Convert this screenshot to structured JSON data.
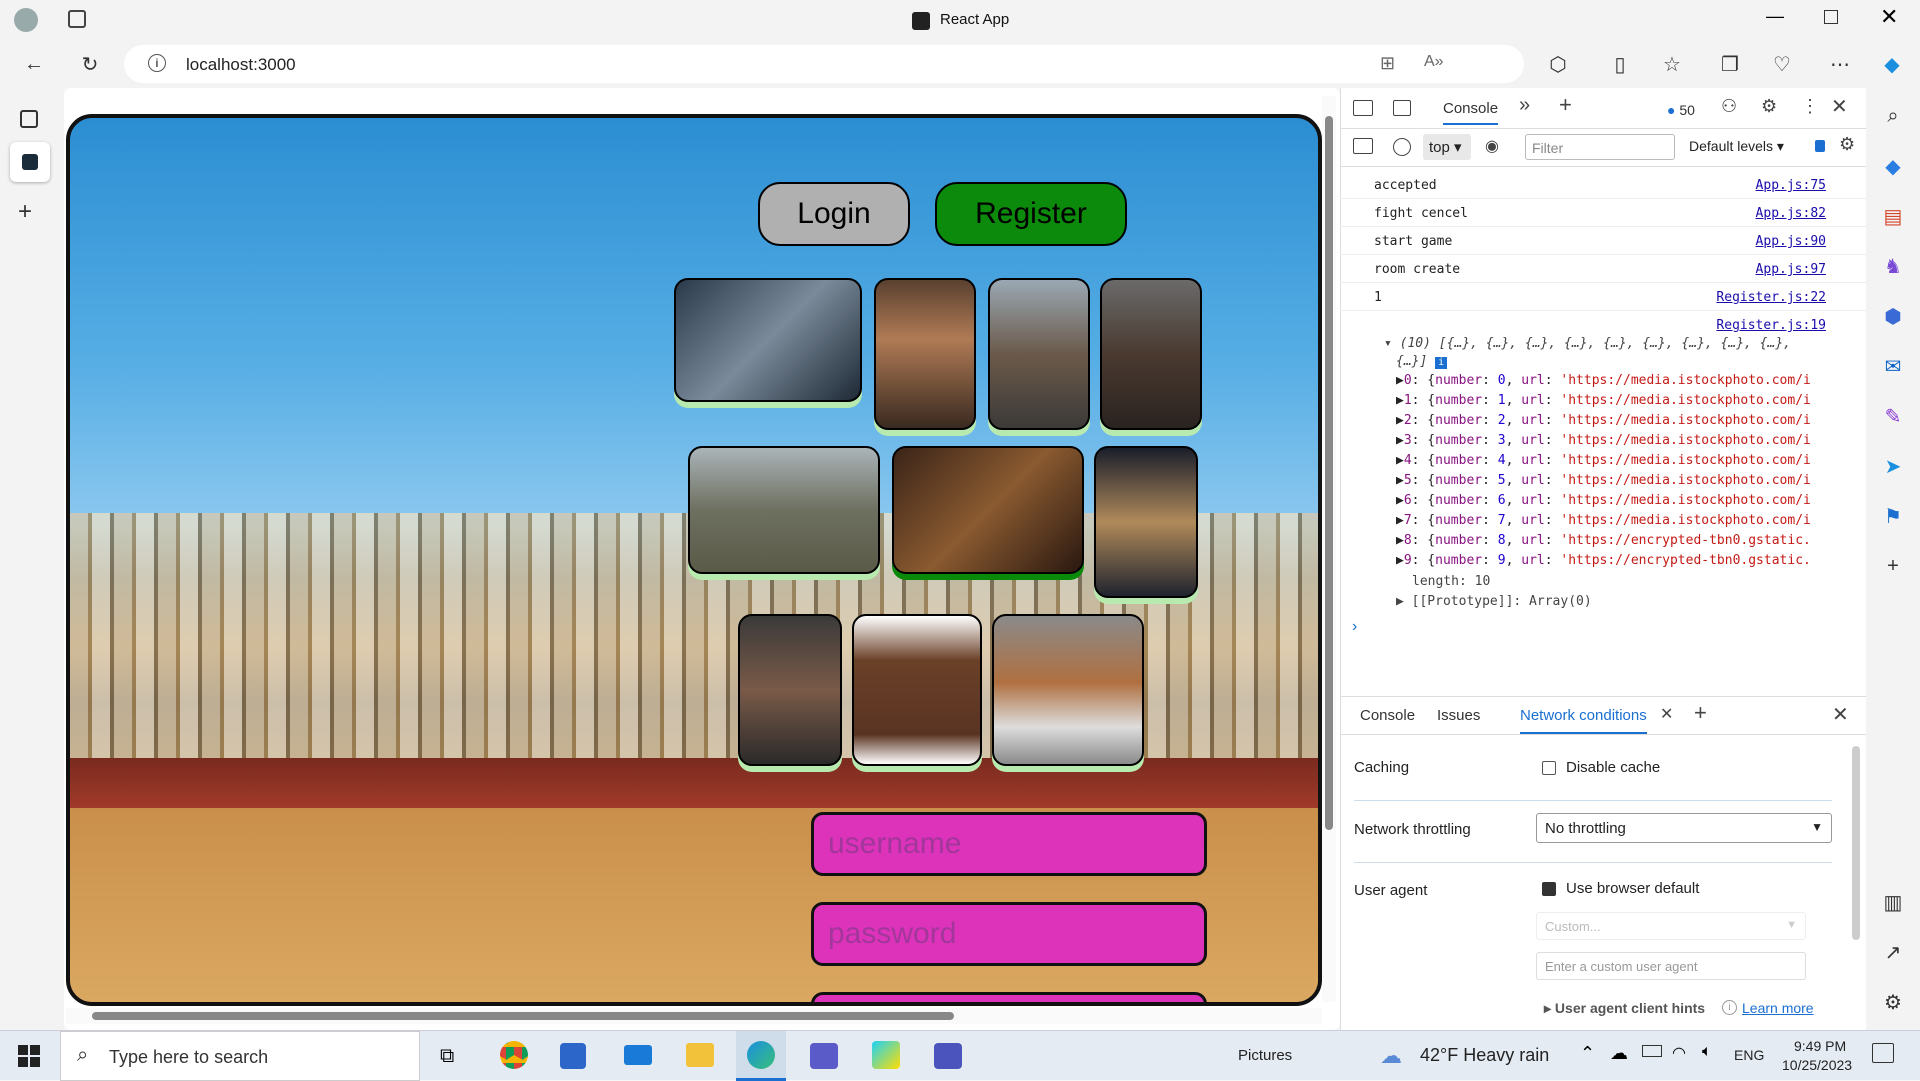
{
  "window": {
    "title": "React App"
  },
  "browser": {
    "url": "localhost:3000"
  },
  "page": {
    "login_label": "Login",
    "register_label": "Register",
    "username_placeholder": "username",
    "password_placeholder": "password"
  },
  "devtools": {
    "tabs": [
      "Console"
    ],
    "message_count": "50",
    "context": "top",
    "filter_placeholder": "Filter",
    "levels": "Default levels",
    "logs": [
      {
        "text": "accepted",
        "source": "App.js:75"
      },
      {
        "text": "fight cencel",
        "source": "App.js:82"
      },
      {
        "text": "start game",
        "source": "App.js:90"
      },
      {
        "text": "room create",
        "source": "App.js:97"
      },
      {
        "text": "1",
        "source": "Register.js:22"
      }
    ],
    "array_source": "Register.js:19",
    "array_header": "(10) [{…}, {…}, {…}, {…}, {…}, {…}, {…}, {…}, {…},",
    "array_header_tail": "{…}]",
    "array_items": [
      {
        "idx": "0",
        "num": "0",
        "url": "'https://media.istockphoto.com/i"
      },
      {
        "idx": "1",
        "num": "1",
        "url": "'https://media.istockphoto.com/i"
      },
      {
        "idx": "2",
        "num": "2",
        "url": "'https://media.istockphoto.com/i"
      },
      {
        "idx": "3",
        "num": "3",
        "url": "'https://media.istockphoto.com/i"
      },
      {
        "idx": "4",
        "num": "4",
        "url": "'https://media.istockphoto.com/i"
      },
      {
        "idx": "5",
        "num": "5",
        "url": "'https://media.istockphoto.com/i"
      },
      {
        "idx": "6",
        "num": "6",
        "url": "'https://media.istockphoto.com/i"
      },
      {
        "idx": "7",
        "num": "7",
        "url": "'https://media.istockphoto.com/i"
      },
      {
        "idx": "8",
        "num": "8",
        "url": "'https://encrypted-tbn0.gstatic."
      },
      {
        "idx": "9",
        "num": "9",
        "url": "'https://encrypted-tbn0.gstatic."
      }
    ],
    "length_line": "length: 10",
    "proto_line": "[[Prototype]]: Array(0)",
    "drawer_tabs": [
      "Console",
      "Issues",
      "Network conditions"
    ],
    "caching_label": "Caching",
    "disable_cache_label": "Disable cache",
    "throttling_label": "Network throttling",
    "throttling_value": "No throttling",
    "user_agent_label": "User agent",
    "use_browser_default_label": "Use browser default",
    "custom_placeholder": "Custom...",
    "custom_ua_placeholder": "Enter a custom user agent",
    "client_hints_label": "User agent client hints",
    "learn_more": "Learn more"
  },
  "taskbar": {
    "search_placeholder": "Type here to search",
    "pictures_label": "Pictures",
    "weather": "42°F  Heavy rain",
    "lang": "ENG",
    "time": "9:49 PM",
    "date": "10/25/2023"
  }
}
